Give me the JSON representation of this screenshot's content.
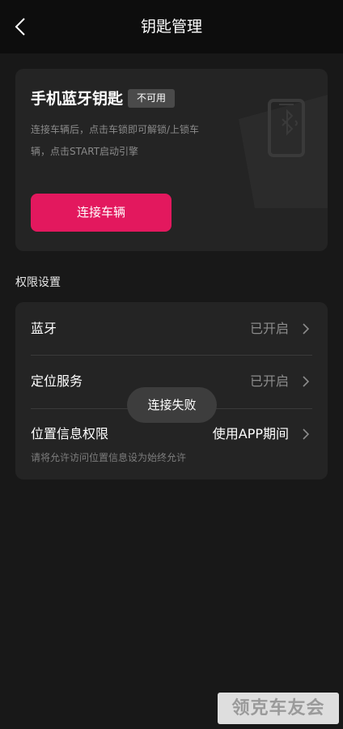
{
  "header": {
    "title": "钥匙管理",
    "back_icon": "chevron-left-icon"
  },
  "bluetooth_key": {
    "title": "手机蓝牙钥匙",
    "badge": "不可用",
    "description": "连接车辆后，点击车锁即可解锁/上锁车辆，点击START启动引擎",
    "connect_label": "连接车辆",
    "decor_icon": "phone-bluetooth-icon"
  },
  "permissions": {
    "section_title": "权限设置",
    "items": [
      {
        "label": "蓝牙",
        "value": "已开启"
      },
      {
        "label": "定位服务",
        "value": "已开启"
      },
      {
        "label": "位置信息权限",
        "value": "使用APP期间",
        "hint": "请将允许访问位置信息设为始终允许"
      }
    ]
  },
  "toast": {
    "text": "连接失败"
  },
  "watermark": {
    "text": "领克车友会"
  },
  "colors": {
    "accent": "#e3185e",
    "background": "#181818",
    "card": "#242424"
  }
}
